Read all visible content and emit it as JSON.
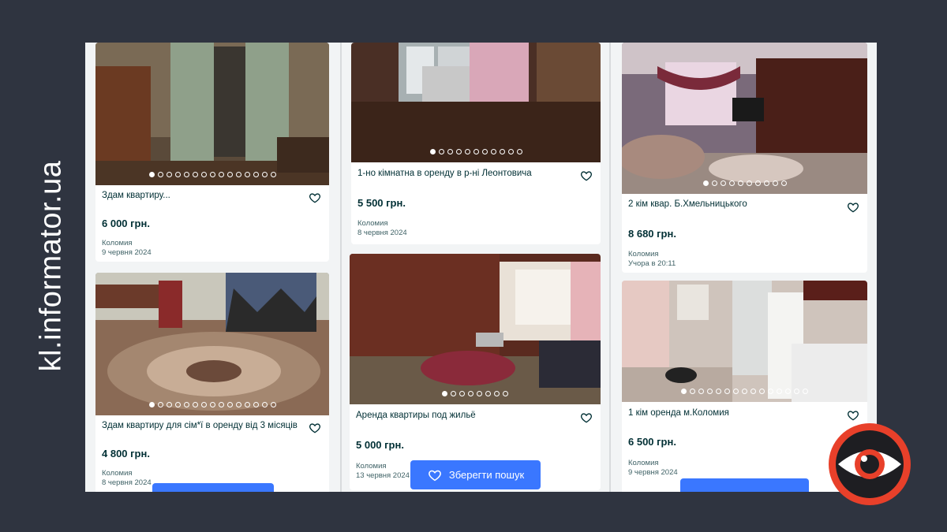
{
  "watermark": "kl.informator.ua",
  "save_search": {
    "label": "Зберегти пошук"
  },
  "listings": [
    {
      "title": "Здам квартиру...",
      "price": "6 000 грн.",
      "location": "Коломия",
      "date": "9 червня 2024",
      "photos": 15,
      "active_photo": 1
    },
    {
      "title": "Здам квартиру для сім*ї  в оренду від 3 місяців",
      "price": "4 800 грн.",
      "location": "Коломия",
      "date": "8 червня 2024",
      "photos": 15,
      "active_photo": 1
    },
    {
      "title": "1-но кімнатна в оренду в р-ні Леонтовича",
      "price": "5 500 грн.",
      "location": "Коломия",
      "date": "8 червня 2024",
      "photos": 11,
      "active_photo": 1
    },
    {
      "title": "Аренда квартиры под жильё",
      "price": "5 000 грн.",
      "location": "Коломия",
      "date": "13 червня 2024",
      "photos": 8,
      "active_photo": 1
    },
    {
      "title": "2 кім квар. Б.Хмельницького",
      "price": "8 680 грн.",
      "location": "Коломия",
      "date": "Учора в 20:11",
      "photos": 10,
      "active_photo": 1
    },
    {
      "title": "1 кім оренда м.Коломия",
      "price": "6 500 грн.",
      "location": "Коломия",
      "date": "9 червня 2024",
      "photos": 15,
      "active_photo": 1
    }
  ],
  "icons": {
    "favorite": "heart-outline-icon",
    "logo": "eye-icon"
  },
  "colors": {
    "background": "#2f3440",
    "primary_button": "#3a77ff",
    "logo_red": "#e8402a",
    "text_dark": "#002f34"
  }
}
